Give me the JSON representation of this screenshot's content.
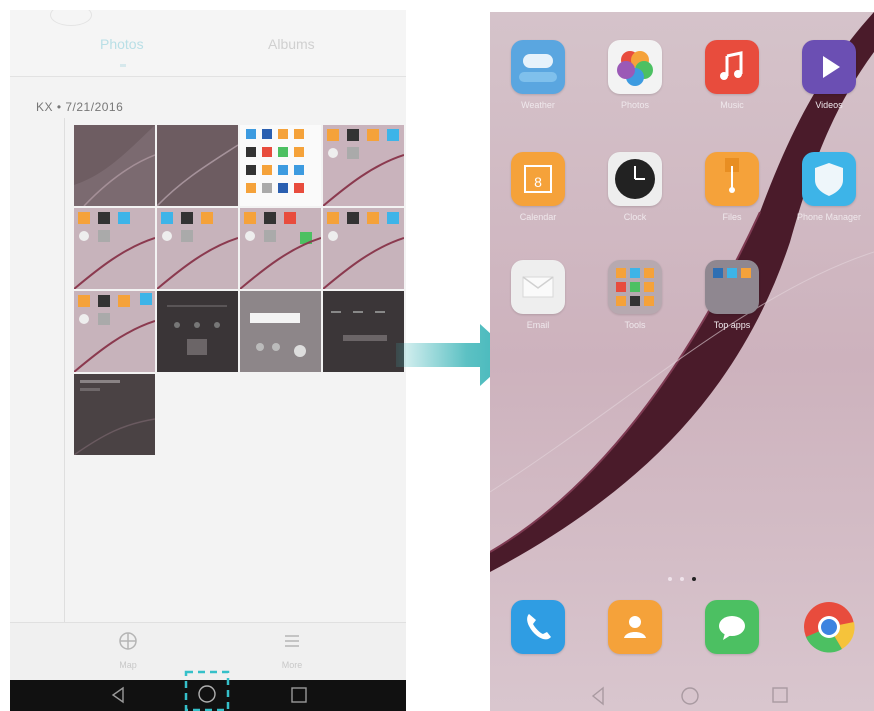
{
  "gallery": {
    "tabs": {
      "photos": "Photos",
      "albums": "Albums"
    },
    "date_header": "KX  •  7/21/2016",
    "bottom_bar": {
      "map_label": "Map",
      "more_label": "More"
    }
  },
  "home": {
    "apps": [
      {
        "name": "weather-app-icon",
        "label": "Weather",
        "color": "#5aa6e0"
      },
      {
        "name": "photos-app-icon",
        "label": "Photos",
        "color": "#f3f3f3"
      },
      {
        "name": "music-app-icon",
        "label": "Music",
        "color": "#e84c3d"
      },
      {
        "name": "videos-app-icon",
        "label": "Videos",
        "color": "#6b4fb3"
      },
      {
        "name": "calendar-app-icon",
        "label": "Calendar",
        "color": "#f5a23a"
      },
      {
        "name": "clock-app-icon",
        "label": "Clock",
        "color": "#eeeeee"
      },
      {
        "name": "files-app-icon",
        "label": "Files",
        "color": "#f5a23a"
      },
      {
        "name": "phone-manager-app-icon",
        "label": "Phone Manager",
        "color": "#3db4e8"
      },
      {
        "name": "email-app-icon",
        "label": "Email",
        "color": "#eeeeee"
      },
      {
        "name": "tools-folder-icon",
        "label": "Tools",
        "color": "#b7a9b0"
      },
      {
        "name": "top-apps-folder-icon",
        "label": "Top apps",
        "color": "#8f8790"
      }
    ],
    "dock": [
      {
        "name": "dialer-app-icon",
        "color": "#2f9de3"
      },
      {
        "name": "contacts-app-icon",
        "color": "#f5a23a"
      },
      {
        "name": "messaging-app-icon",
        "color": "#4cc062"
      },
      {
        "name": "chrome-app-icon",
        "color": "#ffffff"
      }
    ],
    "page_indicator": {
      "pages": 3,
      "current": 3
    }
  },
  "colors": {
    "arrow": "#3fb6b9",
    "highlight": "#35c0c9",
    "nav_bar": "#111111"
  }
}
